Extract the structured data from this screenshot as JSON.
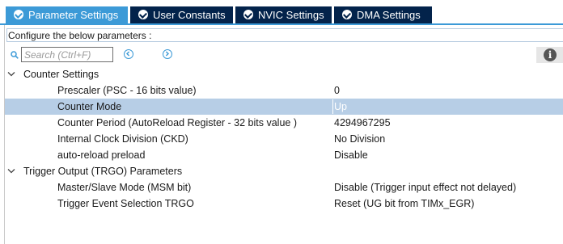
{
  "tabs": [
    {
      "label": "Parameter Settings",
      "active": true
    },
    {
      "label": "User Constants",
      "active": false
    },
    {
      "label": "NVIC Settings",
      "active": false
    },
    {
      "label": "DMA Settings",
      "active": false
    }
  ],
  "panel": {
    "config_label": "Configure the below parameters :",
    "search": {
      "placeholder": "Search (Ctrl+F)",
      "value": ""
    },
    "info_icon": "i"
  },
  "tree": {
    "counter_settings": {
      "label": "Counter Settings",
      "params": [
        {
          "name": "Prescaler (PSC - 16 bits value)",
          "value": "0"
        },
        {
          "name": "Counter Mode",
          "value": "Up",
          "selected": true
        },
        {
          "name": "Counter Period (AutoReload Register - 32 bits value )",
          "value": "4294967295"
        },
        {
          "name": "Internal Clock Division (CKD)",
          "value": "No Division"
        },
        {
          "name": "auto-reload preload",
          "value": "Disable"
        }
      ]
    },
    "trigger_output": {
      "label": "Trigger Output (TRGO) Parameters",
      "params": [
        {
          "name": "Master/Slave Mode (MSM bit)",
          "value": "Disable (Trigger input effect not delayed)"
        },
        {
          "name": "Trigger Event Selection TRGO",
          "value": "Reset (UG bit from TIMx_EGR)"
        }
      ]
    }
  },
  "colors": {
    "tab_active": "#3c9ad7",
    "tab_inactive": "#03234b",
    "row_selected": "#b7cee6"
  }
}
